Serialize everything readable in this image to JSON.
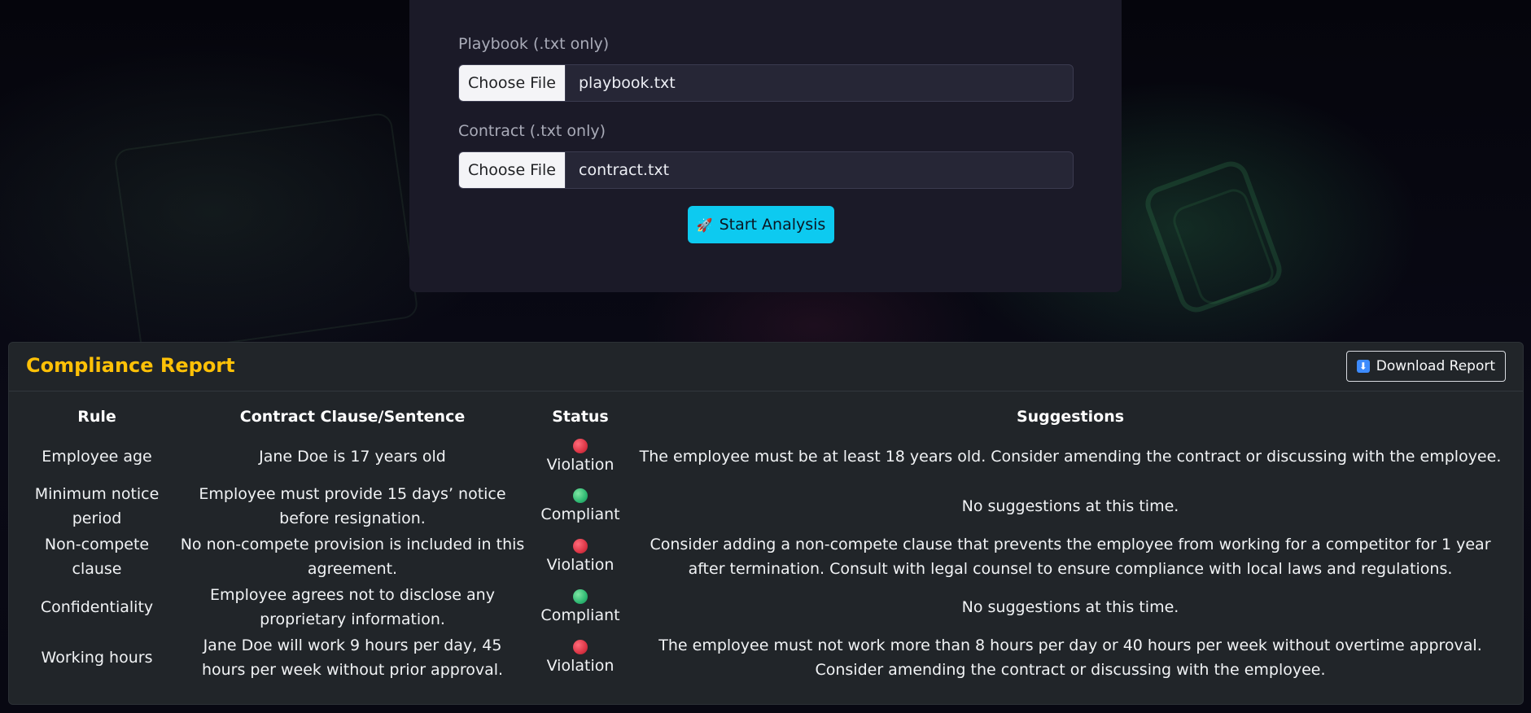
{
  "upload": {
    "playbook_label": "Playbook (.txt only)",
    "playbook_button": "Choose File",
    "playbook_file": "playbook.txt",
    "contract_label": "Contract (.txt only)",
    "contract_button": "Choose File",
    "contract_file": "contract.txt",
    "start_icon": "🚀",
    "start_label": "Start Analysis"
  },
  "report": {
    "title": "Compliance Report",
    "download_icon": "⬇",
    "download_label": "Download Report",
    "columns": [
      "Rule",
      "Contract Clause/Sentence",
      "Status",
      "Suggestions"
    ],
    "rows": [
      {
        "rule": "Employee age",
        "clause": "Jane Doe is 17 years old",
        "status": "Violation",
        "status_color": "#dc3545",
        "suggestion": "The employee must be at least 18 years old. Consider amending the contract or discussing with the employee."
      },
      {
        "rule": "Minimum notice period",
        "clause": "Employee must provide 15 days’ notice before resignation.",
        "status": "Compliant",
        "status_color": "#2eb872",
        "suggestion": "No suggestions at this time."
      },
      {
        "rule": "Non-compete clause",
        "clause": "No non-compete provision is included in this agreement.",
        "status": "Violation",
        "status_color": "#dc3545",
        "suggestion": "Consider adding a non-compete clause that prevents the employee from working for a competitor for 1 year after termination. Consult with legal counsel to ensure compliance with local laws and regulations."
      },
      {
        "rule": "Confidentiality",
        "clause": "Employee agrees not to disclose any proprietary information.",
        "status": "Compliant",
        "status_color": "#2eb872",
        "suggestion": "No suggestions at this time."
      },
      {
        "rule": "Working hours",
        "clause": "Jane Doe will work 9 hours per day, 45 hours per week without prior approval.",
        "status": "Violation",
        "status_color": "#dc3545",
        "suggestion": "The employee must not work more than 8 hours per day or 40 hours per week without overtime approval. Consider amending the contract or discussing with the employee."
      }
    ]
  }
}
